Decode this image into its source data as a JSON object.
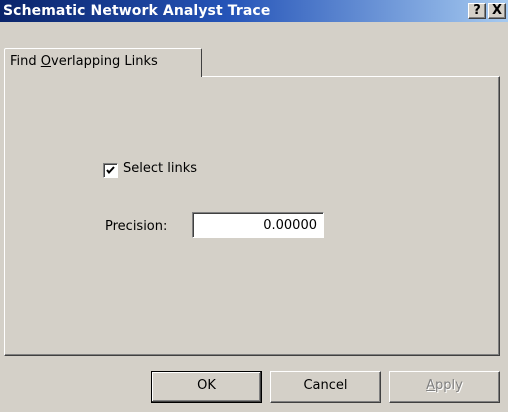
{
  "window": {
    "title": "Schematic Network Analyst Trace",
    "help_button": "?",
    "close_button": "X"
  },
  "tabs": [
    {
      "label_prefix": "Find ",
      "label_accel": "O",
      "label_suffix": "verlapping Links",
      "active": true
    }
  ],
  "options": {
    "select_links_label": "Select links",
    "select_links_checked": true,
    "precision_label": "Precision:",
    "precision_value": "0.00000"
  },
  "buttons": {
    "ok_label": "OK",
    "cancel_label": "Cancel",
    "apply_accel": "A",
    "apply_rest": "pply",
    "apply_enabled": false
  }
}
